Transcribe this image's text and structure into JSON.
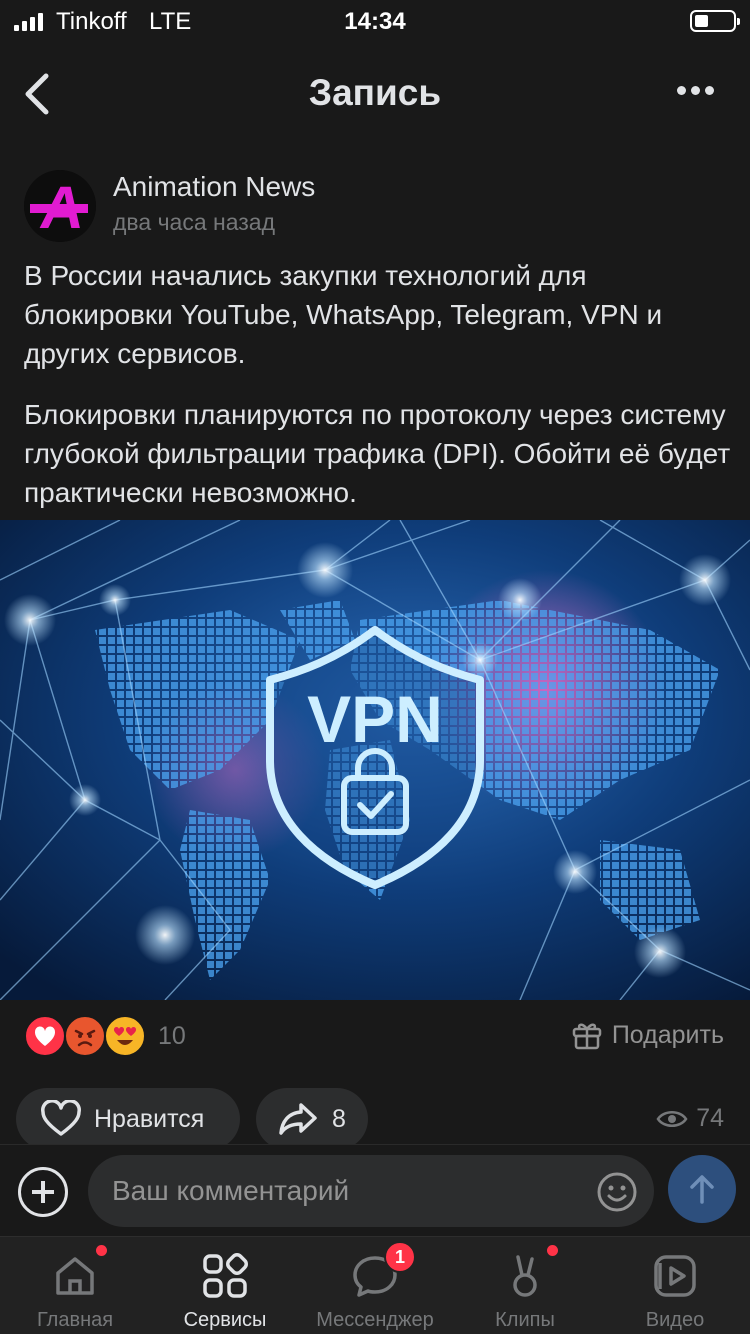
{
  "status_bar": {
    "carrier": "Tinkoff",
    "network": "LTE",
    "time": "14:34",
    "battery_level": 0.35
  },
  "header": {
    "title": "Запись",
    "back_icon": "chevron-left-icon",
    "more_icon": "more-horizontal-icon"
  },
  "post": {
    "author": "Animation News",
    "avatar_letter": "A",
    "time": "два часа назад",
    "paragraphs": [
      "В России начались закупки технологий для блокировки YouTube, WhatsApp, Telegram, VPN и других сервисов.",
      "Блокировки планируются по протоколу через систему глубокой фильтрации трафика (DPI). Обойти её будет практически невозможно."
    ],
    "image_text": "VPN",
    "reactions": [
      "heart",
      "angry",
      "heart-eyes"
    ],
    "reaction_count": "10",
    "gift_label": "Подарить",
    "like_label": "Нравится",
    "share_count": "8",
    "views": "74"
  },
  "comment": {
    "placeholder": "Ваш комментарий"
  },
  "tabs": [
    {
      "label": "Главная",
      "icon": "home-icon",
      "dot": true
    },
    {
      "label": "Сервисы",
      "icon": "services-icon",
      "active": true
    },
    {
      "label": "Мессенджер",
      "icon": "messenger-icon",
      "badge": "1"
    },
    {
      "label": "Клипы",
      "icon": "clips-icon",
      "dot": true
    },
    {
      "label": "Видео",
      "icon": "video-icon"
    }
  ],
  "colors": {
    "background": "#191919",
    "accent": "#2d4f7d",
    "badge": "#ff3347",
    "avatar_letter": "#e11bd1"
  }
}
